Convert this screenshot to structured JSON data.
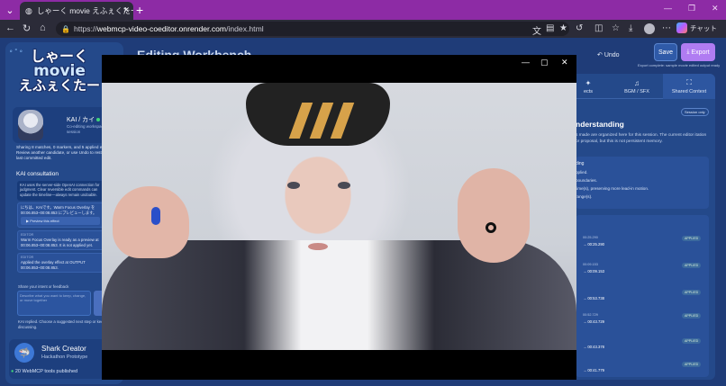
{
  "browser": {
    "tab_title": "しゃーく movie えふぇくたー — Editing",
    "url_prefix": "https://",
    "url_host": "webmcp-video-coeditor.onrender.com",
    "url_path": "/index.html",
    "copilot_label": "チャット"
  },
  "sidebar": {
    "logo": {
      "line1": "しゃーく",
      "line2": "movie",
      "line3": "えふぇくたー"
    },
    "profile": {
      "name": "KAI / カイ",
      "subtitle": "Co-editing workspace · live session"
    },
    "session_info": "Sharing 8 matches, 0 markers, and 5 applied edits. Review another candidate, or use Undo to restore the last committed edit.",
    "consult_title": "KAI consultation",
    "consult_desc": "KAI uses the server-side OpenAI connection for judgment. Clear reversible edit commands can update the timeline—always remain undoable.",
    "messages": [
      {
        "who": "",
        "text": "にちは、KAIです。Warm Focus Overlay を 00:06.853–00:08.853 にプレビューします。",
        "button": "Preview this effect"
      },
      {
        "who": "EDITOR",
        "text": "Warm Focus Overlay is ready as a preview at 00:06.853–00:08.853. It is not applied yet.",
        "button": ""
      },
      {
        "who": "EDITOR",
        "text": "Applied the overlay effect at OUTPUT 00:06.853–00:08.853.",
        "button": ""
      }
    ],
    "prompt_label": "Share your intent or feedback",
    "prompt_placeholder": "Describe what you want to keep, change, or move together",
    "reply_note": "KAI replied. Choose a suggested next step or keep discussing.",
    "creator_name": "Shark Creator",
    "creator_sub": "Hackathon Prototype",
    "tools_status": "20 WebMCP tools published"
  },
  "header": {
    "title": "Editing Workbench",
    "undo": "Undo",
    "save": "Save",
    "export": "Export",
    "export_note": "Export complete: sample movie edited output ready"
  },
  "right_panel": {
    "tabs": [
      {
        "label": "ects",
        "icon": "✦"
      },
      {
        "label": "BGM / SFX",
        "icon": "♫"
      },
      {
        "label": "Shared Context",
        "icon": "⛶"
      }
    ],
    "badge": "Session only",
    "heading": "nderstanding",
    "intro": "s made are organized here for this session. The current editor itation or proposal, but this is not persistent memory.",
    "card_heading": "ding",
    "card_items": [
      "pplied.",
      "boundaries.",
      "time(s), preserving more lead-in motion.",
      "range(s)."
    ],
    "list": [
      {
        "t1": "00:25.290",
        "t2": "→ 00:25.290",
        "status": "APPLIED"
      },
      {
        "t1": "00:09.153",
        "t2": "→ 00:09.153",
        "status": "APPLIED"
      },
      {
        "t1": "",
        "t2": "→ 00:53.738",
        "status": "APPLIED"
      },
      {
        "t1": "00:52.729",
        "t2": "→ 00:43.729",
        "status": "APPLIED"
      },
      {
        "t1": "",
        "t2": "→ 00:43.378",
        "status": "APPLIED"
      },
      {
        "t1": "",
        "t2": "→ 00:41.779",
        "status": "APPLIED"
      }
    ]
  }
}
